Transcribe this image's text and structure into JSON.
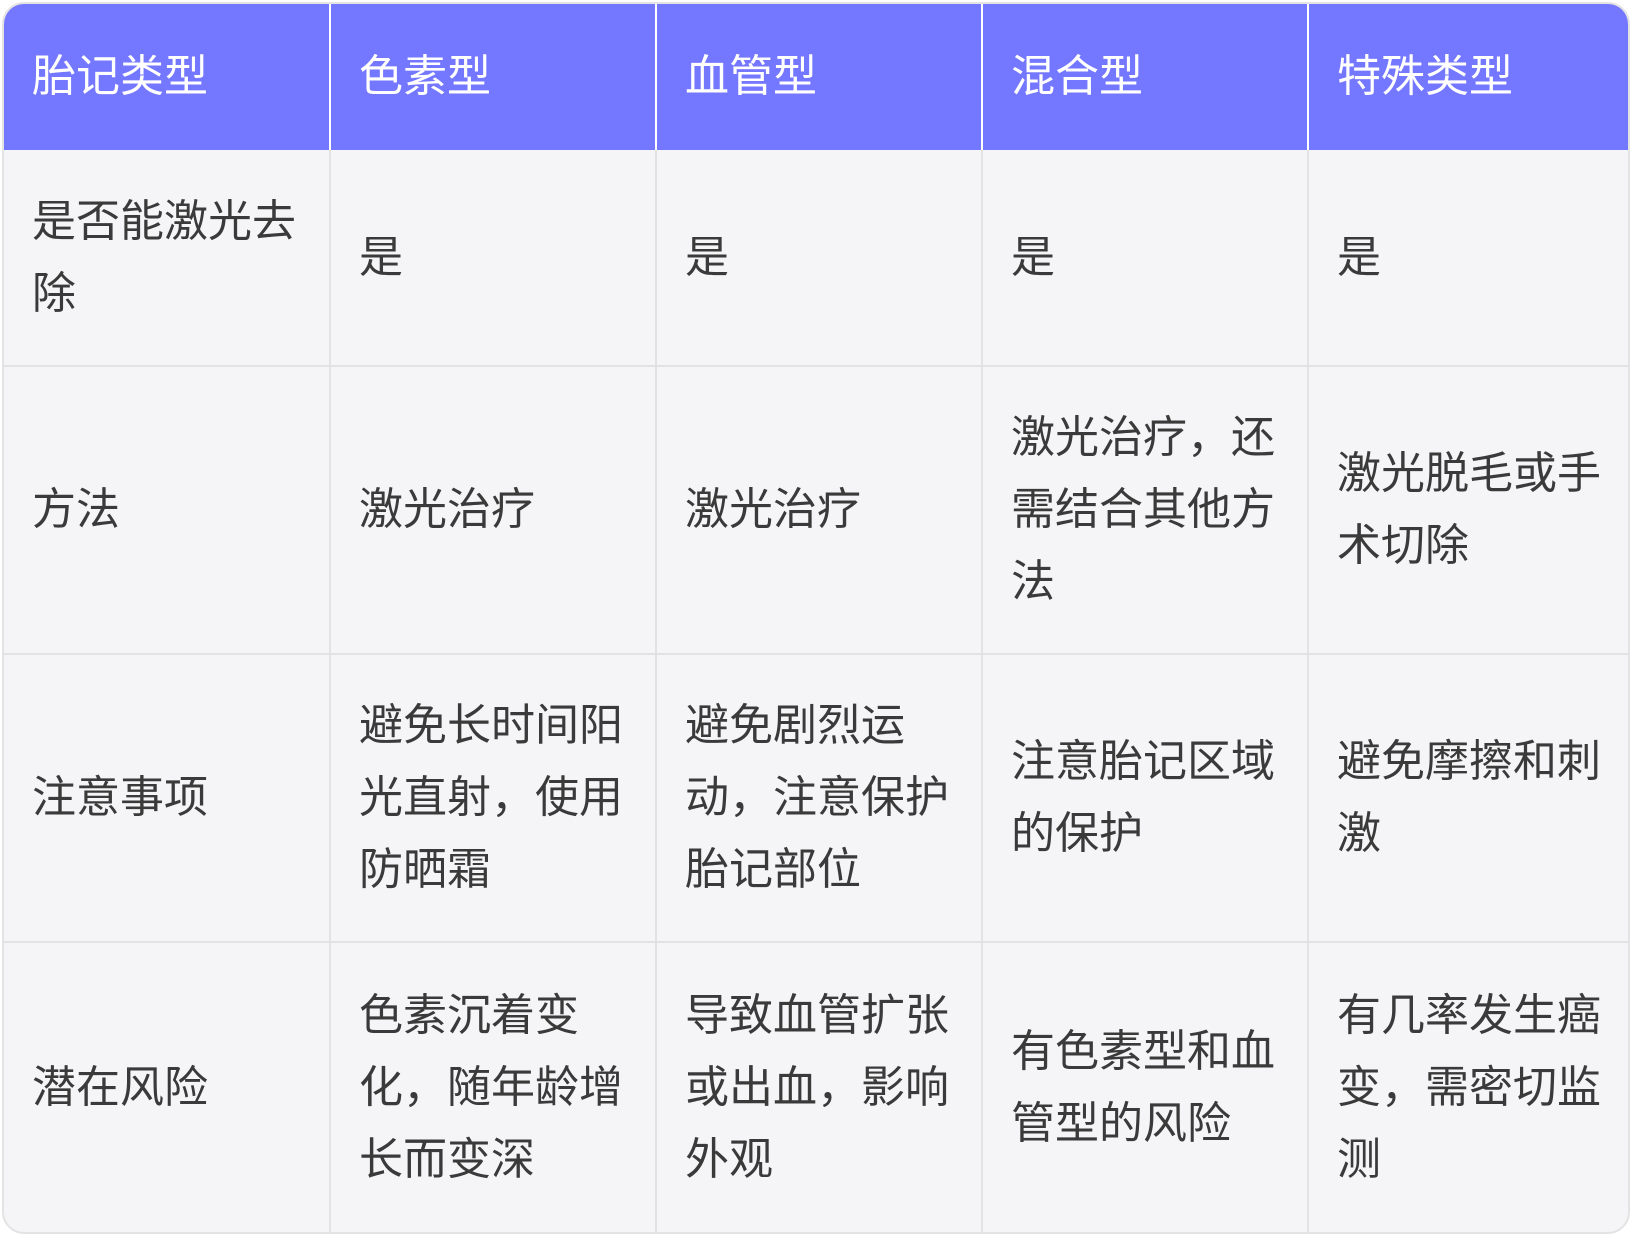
{
  "table": {
    "headers": [
      "胎记类型",
      "色素型",
      "血管型",
      "混合型",
      "特殊类型"
    ],
    "rows": [
      [
        "是否能激光去除",
        "是",
        "是",
        "是",
        "是"
      ],
      [
        "方法",
        "激光治疗",
        "激光治疗",
        "激光治疗，还需结合其他方法",
        "激光脱毛或手术切除"
      ],
      [
        "注意事项",
        "避免长时间阳光直射，使用防晒霜",
        "避免剧烈运动，注意保护胎记部位",
        "注意胎记区域的保护",
        "避免摩擦和刺激"
      ],
      [
        "潜在风险",
        "色素沉着变化，随年龄增长而变深",
        "导致血管扩张或出血，影响外观",
        "有色素型和血管型的风险",
        "有几率发生癌变，需密切监测"
      ]
    ]
  },
  "colors": {
    "header_bg": "#7477ff",
    "header_text": "#ffffff",
    "body_bg": "#f5f5f7",
    "body_text": "#3a3a3a",
    "grid_line": "#e2e2e2"
  }
}
